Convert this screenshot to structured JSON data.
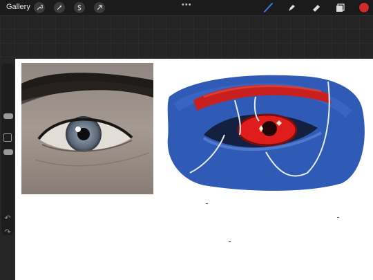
{
  "topbar": {
    "gallery_label": "Gallery",
    "left_tools": [
      "wrench-icon",
      "magic-wand-icon",
      "selection-s-icon",
      "move-arrow-icon"
    ],
    "more_label": "•••",
    "right_tools": [
      "brush-icon",
      "smudge-icon",
      "eraser-icon",
      "layers-icon"
    ],
    "current_color": "#d02a2a"
  },
  "sidebar": {
    "controls": [
      "brush-size-slider",
      "modify-square-button",
      "opacity-slider",
      "undo-button",
      "redo-button"
    ],
    "undo_glyph": "↶",
    "redo_glyph": "↷"
  },
  "canvas": {
    "reference_photo": "eye-photo",
    "artwork": "painted-eye",
    "colors": {
      "skin": "#2f5bb6",
      "brow": "#c8201e",
      "iris": "#e01d1d",
      "background": "#ffffff"
    }
  }
}
